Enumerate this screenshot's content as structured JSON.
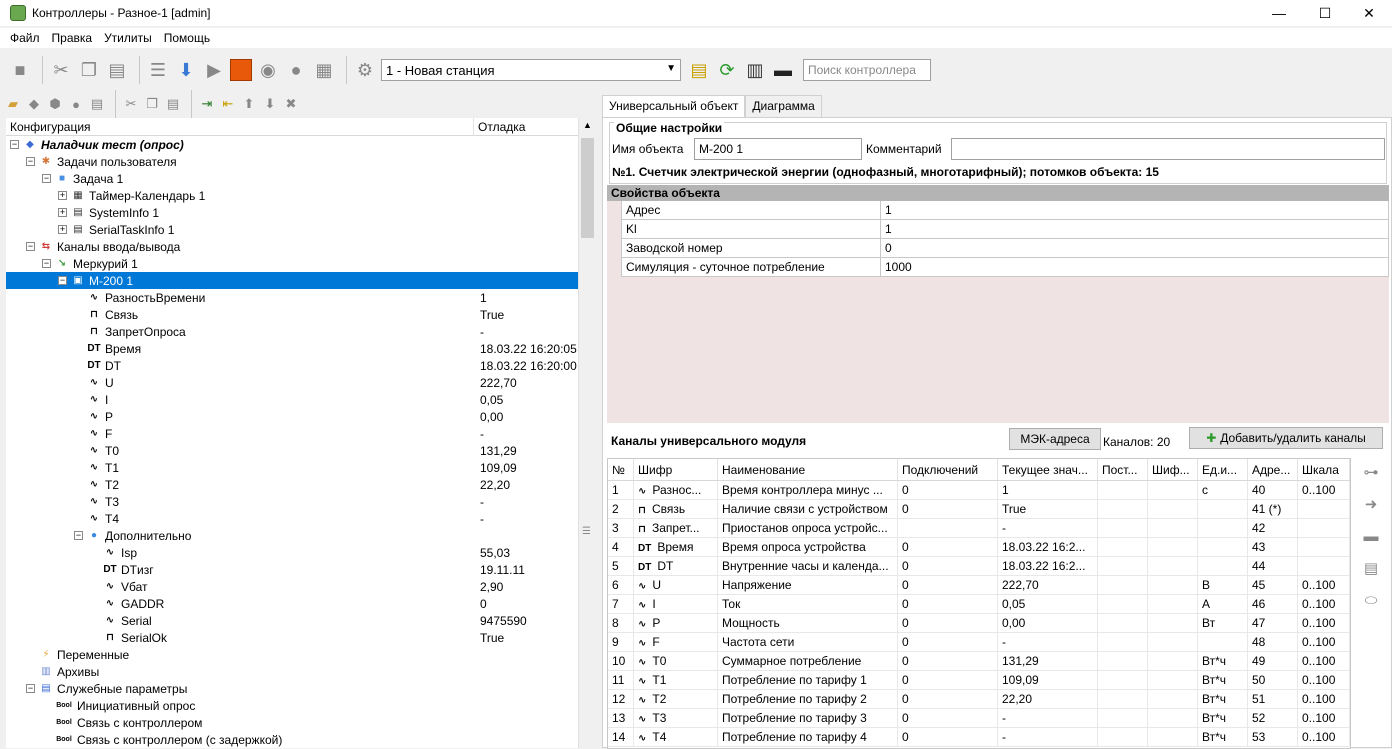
{
  "window": {
    "title": "Контроллеры - Разное-1 [admin]",
    "minimize": "—",
    "maximize": "☐",
    "close": "✕"
  },
  "menu": [
    "Файл",
    "Правка",
    "Утилиты",
    "Помощь"
  ],
  "toolbar": {
    "station": "1 - Новая станция",
    "search_placeholder": "Поиск контроллера"
  },
  "tree": {
    "headers": [
      "Конфигурация",
      "Отладка"
    ],
    "rows": [
      {
        "level": 0,
        "exp": "−",
        "icon": "◆",
        "color": "#3a6ad4",
        "label": "Наладчик тест (опрос)",
        "value": "",
        "bold": true
      },
      {
        "level": 1,
        "exp": "−",
        "icon": "✱",
        "color": "#d4783a",
        "label": "Задачи пользователя",
        "value": ""
      },
      {
        "level": 2,
        "exp": "−",
        "icon": "■",
        "color": "#4a90e2",
        "label": "Задача 1",
        "value": ""
      },
      {
        "level": 3,
        "exp": "+",
        "icon": "▦",
        "color": "#333",
        "label": "Таймер-Календарь 1",
        "value": ""
      },
      {
        "level": 3,
        "exp": "+",
        "icon": "▤",
        "color": "#333",
        "label": "SystemInfo 1",
        "value": ""
      },
      {
        "level": 3,
        "exp": "+",
        "icon": "▤",
        "color": "#333",
        "label": "SerialTaskInfo 1",
        "value": ""
      },
      {
        "level": 1,
        "exp": "−",
        "icon": "⇆",
        "color": "#d43a3a",
        "label": "Каналы ввода/вывода",
        "value": ""
      },
      {
        "level": 2,
        "exp": "−",
        "icon": "↘",
        "color": "#3a9a3a",
        "label": "Меркурий 1",
        "value": ""
      },
      {
        "level": 3,
        "exp": "−",
        "icon": "▣",
        "color": "#e8c23a",
        "label": "М-200 1",
        "value": "",
        "selected": true
      },
      {
        "level": 4,
        "icon": "∿",
        "color": "#000",
        "label": "РазностьВремени",
        "value": "1"
      },
      {
        "level": 4,
        "icon": "⊓",
        "color": "#000",
        "label": "Связь",
        "value": "True"
      },
      {
        "level": 4,
        "icon": "⊓",
        "color": "#000",
        "label": "ЗапретОпроса",
        "value": "-"
      },
      {
        "level": 4,
        "icon": "DT",
        "color": "#000",
        "label": "Время",
        "value": "18.03.22 16:20:05"
      },
      {
        "level": 4,
        "icon": "DT",
        "color": "#000",
        "label": "DT",
        "value": "18.03.22 16:20:00"
      },
      {
        "level": 4,
        "icon": "∿",
        "color": "#000",
        "label": "U",
        "value": "222,70"
      },
      {
        "level": 4,
        "icon": "∿",
        "color": "#000",
        "label": "I",
        "value": "0,05"
      },
      {
        "level": 4,
        "icon": "∿",
        "color": "#000",
        "label": "P",
        "value": "0,00"
      },
      {
        "level": 4,
        "icon": "∿",
        "color": "#000",
        "label": "F",
        "value": "-"
      },
      {
        "level": 4,
        "icon": "∿",
        "color": "#000",
        "label": "T0",
        "value": "131,29"
      },
      {
        "level": 4,
        "icon": "∿",
        "color": "#000",
        "label": "T1",
        "value": "109,09"
      },
      {
        "level": 4,
        "icon": "∿",
        "color": "#000",
        "label": "T2",
        "value": "22,20"
      },
      {
        "level": 4,
        "icon": "∿",
        "color": "#000",
        "label": "T3",
        "value": "-"
      },
      {
        "level": 4,
        "icon": "∿",
        "color": "#000",
        "label": "T4",
        "value": "-"
      },
      {
        "level": 4,
        "exp": "−",
        "icon": "●",
        "color": "#3a8ae2",
        "label": "Дополнительно",
        "value": ""
      },
      {
        "level": 5,
        "icon": "∿",
        "color": "#000",
        "label": "Isp",
        "value": "55,03"
      },
      {
        "level": 5,
        "icon": "DT",
        "color": "#000",
        "label": "DTизг",
        "value": "19.11.11"
      },
      {
        "level": 5,
        "icon": "∿",
        "color": "#000",
        "label": "Vбат",
        "value": "2,90"
      },
      {
        "level": 5,
        "icon": "∿",
        "color": "#000",
        "label": "GADDR",
        "value": "0"
      },
      {
        "level": 5,
        "icon": "∿",
        "color": "#000",
        "label": "Serial",
        "value": "9475590"
      },
      {
        "level": 5,
        "icon": "⊓",
        "color": "#000",
        "label": "SerialOk",
        "value": "True"
      },
      {
        "level": 1,
        "icon": "⚡",
        "color": "#e8a23a",
        "label": "Переменные",
        "value": ""
      },
      {
        "level": 1,
        "icon": "▥",
        "color": "#6a8ad4",
        "label": "Архивы",
        "value": ""
      },
      {
        "level": 1,
        "exp": "−",
        "icon": "▤",
        "color": "#3a6ad4",
        "label": "Служебные параметры",
        "value": ""
      },
      {
        "level": 2,
        "icon": "Bool",
        "color": "#000",
        "label": "Инициативный опрос",
        "value": ""
      },
      {
        "level": 2,
        "icon": "Bool",
        "color": "#000",
        "label": "Связь с контроллером",
        "value": ""
      },
      {
        "level": 2,
        "icon": "Bool",
        "color": "#000",
        "label": "Связь с контроллером (с задержкой)",
        "value": ""
      }
    ]
  },
  "tabs": [
    "Универсальный объект",
    "Диаграмма"
  ],
  "general": {
    "title": "Общие настройки",
    "name_label": "Имя объекта",
    "name_value": "М-200 1",
    "comment_label": "Комментарий",
    "comment_value": "",
    "info": "№1. Счетчик электрической энергии (однофазный, многотарифный); потомков объекта: 15"
  },
  "props": {
    "title": "Свойства объекта",
    "rows": [
      [
        "Адрес",
        "1"
      ],
      [
        "Kl",
        "1"
      ],
      [
        "Заводской номер",
        "0"
      ],
      [
        "Симуляция - суточное потребление",
        "1000"
      ]
    ]
  },
  "channels": {
    "title": "Каналы универсального модуля",
    "mek_button": "МЭК-адреса",
    "count": "Каналов: 20",
    "add_button": "Добавить/удалить каналы",
    "headers": [
      "№",
      "Шифр",
      "Наименование",
      "Подключений",
      "Текущее знач...",
      "Пост...",
      "Шиф...",
      "Ед.и...",
      "Адре...",
      "Шкала"
    ],
    "rows": [
      [
        "1",
        "∿",
        "Разнос...",
        "Время контроллера минус ...",
        "0",
        "1",
        "",
        "",
        "с",
        "40",
        "0..100"
      ],
      [
        "2",
        "⊓",
        "Связь",
        "Наличие связи с устройством",
        "0",
        "True",
        "",
        "",
        "",
        "41 (*)",
        ""
      ],
      [
        "3",
        "⊓",
        "Запрет...",
        "Приостанов опроса устройс...",
        "",
        "-",
        "",
        "",
        "",
        "42",
        ""
      ],
      [
        "4",
        "DT",
        "Время",
        "Время опроса устройства",
        "0",
        "18.03.22 16:2...",
        "",
        "",
        "",
        "43",
        ""
      ],
      [
        "5",
        "DT",
        "DT",
        "Внутренние часы и календа...",
        "0",
        "18.03.22 16:2...",
        "",
        "",
        "",
        "44",
        ""
      ],
      [
        "6",
        "∿",
        "U",
        "Напряжение",
        "0",
        "222,70",
        "",
        "",
        "В",
        "45",
        "0..100"
      ],
      [
        "7",
        "∿",
        "I",
        "Ток",
        "0",
        "0,05",
        "",
        "",
        "А",
        "46",
        "0..100"
      ],
      [
        "8",
        "∿",
        "P",
        "Мощность",
        "0",
        "0,00",
        "",
        "",
        "Вт",
        "47",
        "0..100"
      ],
      [
        "9",
        "∿",
        "F",
        "Частота сети",
        "0",
        "-",
        "",
        "",
        "",
        "48",
        "0..100"
      ],
      [
        "10",
        "∿",
        "T0",
        "Суммарное потребление",
        "0",
        "131,29",
        "",
        "",
        "Вт*ч",
        "49",
        "0..100"
      ],
      [
        "11",
        "∿",
        "T1",
        "Потребление по тарифу 1",
        "0",
        "109,09",
        "",
        "",
        "Вт*ч",
        "50",
        "0..100"
      ],
      [
        "12",
        "∿",
        "T2",
        "Потребление по тарифу 2",
        "0",
        "22,20",
        "",
        "",
        "Вт*ч",
        "51",
        "0..100"
      ],
      [
        "13",
        "∿",
        "T3",
        "Потребление по тарифу 3",
        "0",
        "-",
        "",
        "",
        "Вт*ч",
        "52",
        "0..100"
      ],
      [
        "14",
        "∿",
        "T4",
        "Потребление по тарифу 4",
        "0",
        "-",
        "",
        "",
        "Вт*ч",
        "53",
        "0..100"
      ]
    ]
  }
}
